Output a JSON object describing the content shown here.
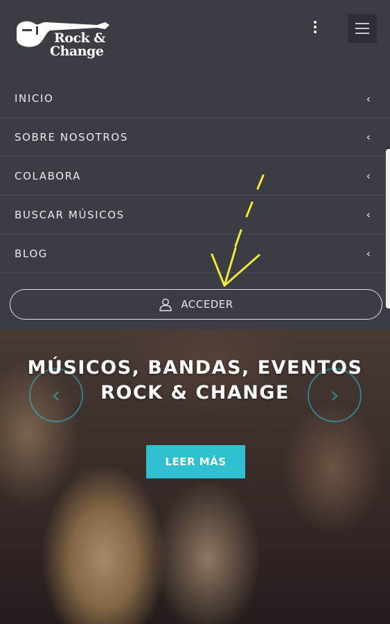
{
  "brand": {
    "line1": "Rock &",
    "line2": "Change"
  },
  "header": {
    "more_icon": "vertical-dots-icon",
    "menu_icon": "hamburger-icon"
  },
  "nav": {
    "items": [
      {
        "label": "INICIO",
        "chevron": "‹"
      },
      {
        "label": "SOBRE NOSOTROS",
        "chevron": "‹"
      },
      {
        "label": "COLABORA",
        "chevron": "‹"
      },
      {
        "label": "BUSCAR MÚSICOS",
        "chevron": "‹"
      },
      {
        "label": "BLOG",
        "chevron": "‹"
      }
    ]
  },
  "login": {
    "label": "ACCEDER",
    "icon": "user-icon"
  },
  "hero": {
    "title_line1": "MÚSICOS, BANDAS, EVENTOS",
    "title_line2": "ROCK & CHANGE",
    "cta": "LEER MÁS",
    "prev": "‹",
    "next": "›"
  },
  "colors": {
    "header_bg": "#3a3d44",
    "accent": "#2fbfcf",
    "annotation": "#f5e83a"
  }
}
